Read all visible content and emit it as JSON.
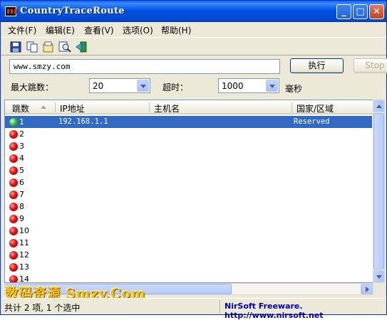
{
  "window": {
    "title": "CountryTraceRoute"
  },
  "menu": [
    {
      "label": "文件(F)"
    },
    {
      "label": "编辑(E)"
    },
    {
      "label": "查看(V)"
    },
    {
      "label": "选项(O)"
    },
    {
      "label": "帮助(H)"
    }
  ],
  "toolbar": {
    "icons": [
      "save-icon",
      "copy-icon",
      "properties-icon",
      "find-icon",
      "exit-icon"
    ]
  },
  "controls": {
    "url_value": "www.smzy.com",
    "execute_label": "执行",
    "stop_label": "Stop",
    "max_hops_label": "最大跳数：",
    "max_hops_value": "20",
    "timeout_label": "超时：",
    "timeout_value": "1000",
    "timeout_unit": "毫秒"
  },
  "list": {
    "columns": [
      "跳数",
      "IP地址",
      "主机名",
      "国家/区域"
    ],
    "rows": [
      {
        "hop": "1",
        "ip": "192.168.1.1",
        "host": "",
        "country": "Reserved",
        "status": "green",
        "selected": true
      },
      {
        "hop": "2",
        "ip": "",
        "host": "",
        "country": "",
        "status": "red"
      },
      {
        "hop": "3",
        "ip": "",
        "host": "",
        "country": "",
        "status": "red"
      },
      {
        "hop": "4",
        "ip": "",
        "host": "",
        "country": "",
        "status": "red"
      },
      {
        "hop": "5",
        "ip": "",
        "host": "",
        "country": "",
        "status": "red"
      },
      {
        "hop": "6",
        "ip": "",
        "host": "",
        "country": "",
        "status": "red"
      },
      {
        "hop": "7",
        "ip": "",
        "host": "",
        "country": "",
        "status": "red"
      },
      {
        "hop": "8",
        "ip": "",
        "host": "",
        "country": "",
        "status": "red"
      },
      {
        "hop": "9",
        "ip": "",
        "host": "",
        "country": "",
        "status": "red"
      },
      {
        "hop": "10",
        "ip": "",
        "host": "",
        "country": "",
        "status": "red"
      },
      {
        "hop": "11",
        "ip": "",
        "host": "",
        "country": "",
        "status": "red"
      },
      {
        "hop": "12",
        "ip": "",
        "host": "",
        "country": "",
        "status": "red"
      },
      {
        "hop": "13",
        "ip": "",
        "host": "",
        "country": "",
        "status": "red"
      },
      {
        "hop": "14",
        "ip": "",
        "host": "",
        "country": "",
        "status": "red"
      }
    ]
  },
  "watermark": "数码资源 Smzy.Com",
  "status": {
    "left": "共计 2 项, 1 个选中",
    "right": "NirSoft Freeware.  http://www.nirsoft.net"
  },
  "colors": {
    "selection": "#316ac5",
    "title_bar": "#0054e3",
    "status_link": "#0000aa"
  }
}
